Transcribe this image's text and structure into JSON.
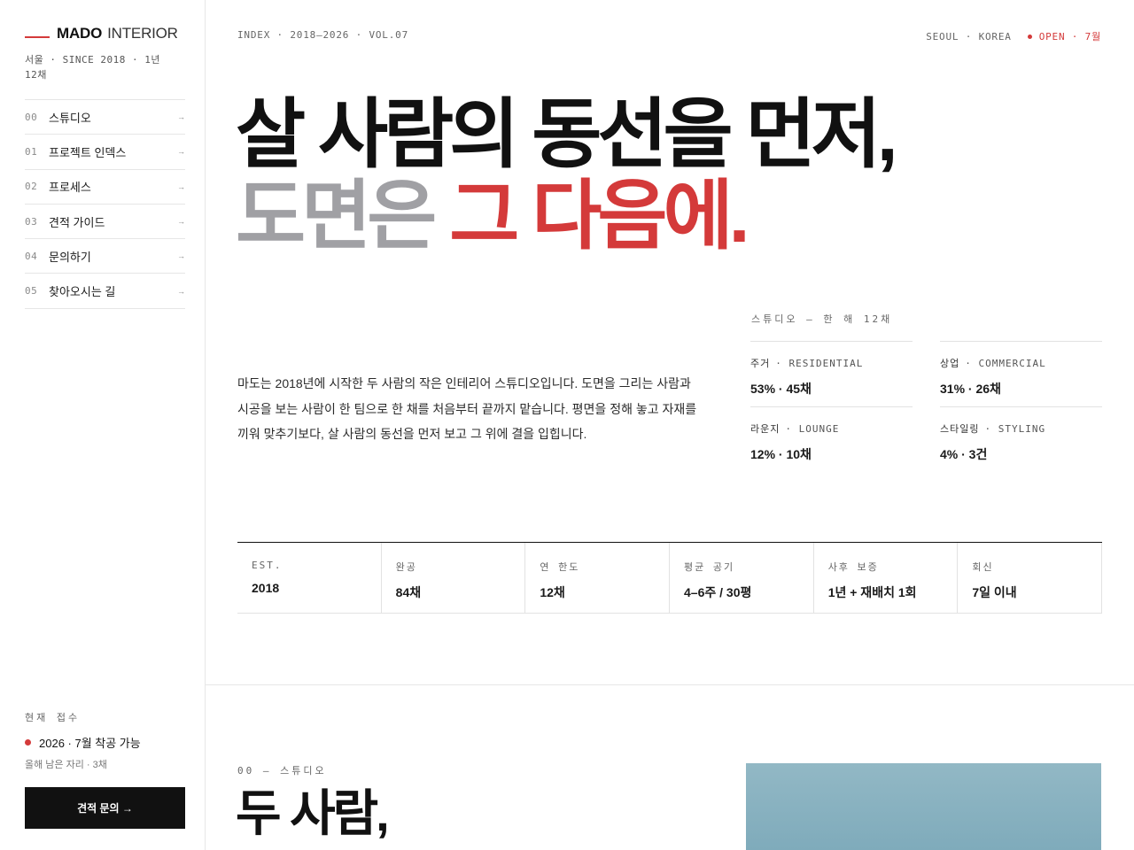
{
  "brand": {
    "name": "MADO",
    "sub": "INTERIOR",
    "meta": "서울 · SINCE 2018 · 1년 12채"
  },
  "nav": [
    {
      "num": "00",
      "label": "스튜디오",
      "arrow": "→"
    },
    {
      "num": "01",
      "label": "프로젝트 인덱스",
      "arrow": "→"
    },
    {
      "num": "02",
      "label": "프로세스",
      "arrow": "→"
    },
    {
      "num": "03",
      "label": "견적 가이드",
      "arrow": "→"
    },
    {
      "num": "04",
      "label": "문의하기",
      "arrow": "→"
    },
    {
      "num": "05",
      "label": "찾아오시는 길",
      "arrow": "→"
    }
  ],
  "status": {
    "title": "현재 접수",
    "line": "2026 · 7월 착공 가능",
    "sub": "올해 남은 자리 · 3채",
    "cta": "견적 문의 →"
  },
  "topbar": {
    "left": "INDEX · 2018–2026 · VOL.07",
    "location": "SEOUL · KOREA",
    "open": "OPEN · 7월"
  },
  "hero": {
    "line1": "살 사람의 동선을 먼저,",
    "line2a": "도면은 ",
    "line2b": "그 다음에."
  },
  "intro": "마도는 2018년에 시작한 두 사람의 작은 인테리어 스튜디오입니다. 도면을 그리는 사람과 시공을 보는 사람이 한 팀으로 한 채를 처음부터 끝까지 맡습니다. 평면을 정해 놓고 자재를 끼워 맞추기보다, 살 사람의 동선을 먼저 보고 그 위에 결을 입힙니다.",
  "mix": {
    "title": "스튜디오 — 한 해 12채",
    "items": [
      {
        "ko": "주거",
        "en": "· RESIDENTIAL",
        "value": "53% · 45채"
      },
      {
        "ko": "상업",
        "en": "· COMMERCIAL",
        "value": "31% · 26채"
      },
      {
        "ko": "라운지",
        "en": "· LOUNGE",
        "value": "12% · 10채"
      },
      {
        "ko": "스타일링",
        "en": "· STYLING",
        "value": "4% · 3건"
      }
    ]
  },
  "stats": [
    {
      "label": "EST.",
      "value": "2018"
    },
    {
      "label": "완공",
      "value": "84채"
    },
    {
      "label": "연 한도",
      "value": "12채"
    },
    {
      "label": "평균 공기",
      "value": "4–6주 / 30평"
    },
    {
      "label": "사후 보증",
      "value": "1년 + 재배치 1회"
    },
    {
      "label": "회신",
      "value": "7일 이내"
    }
  ],
  "section": {
    "label": "00 — 스튜디오",
    "title": "두 사람,"
  },
  "colors": {
    "accent": "#d43a3a",
    "ink": "#111111",
    "muted": "#a0a0a4",
    "photo": "#8ab3c2"
  }
}
